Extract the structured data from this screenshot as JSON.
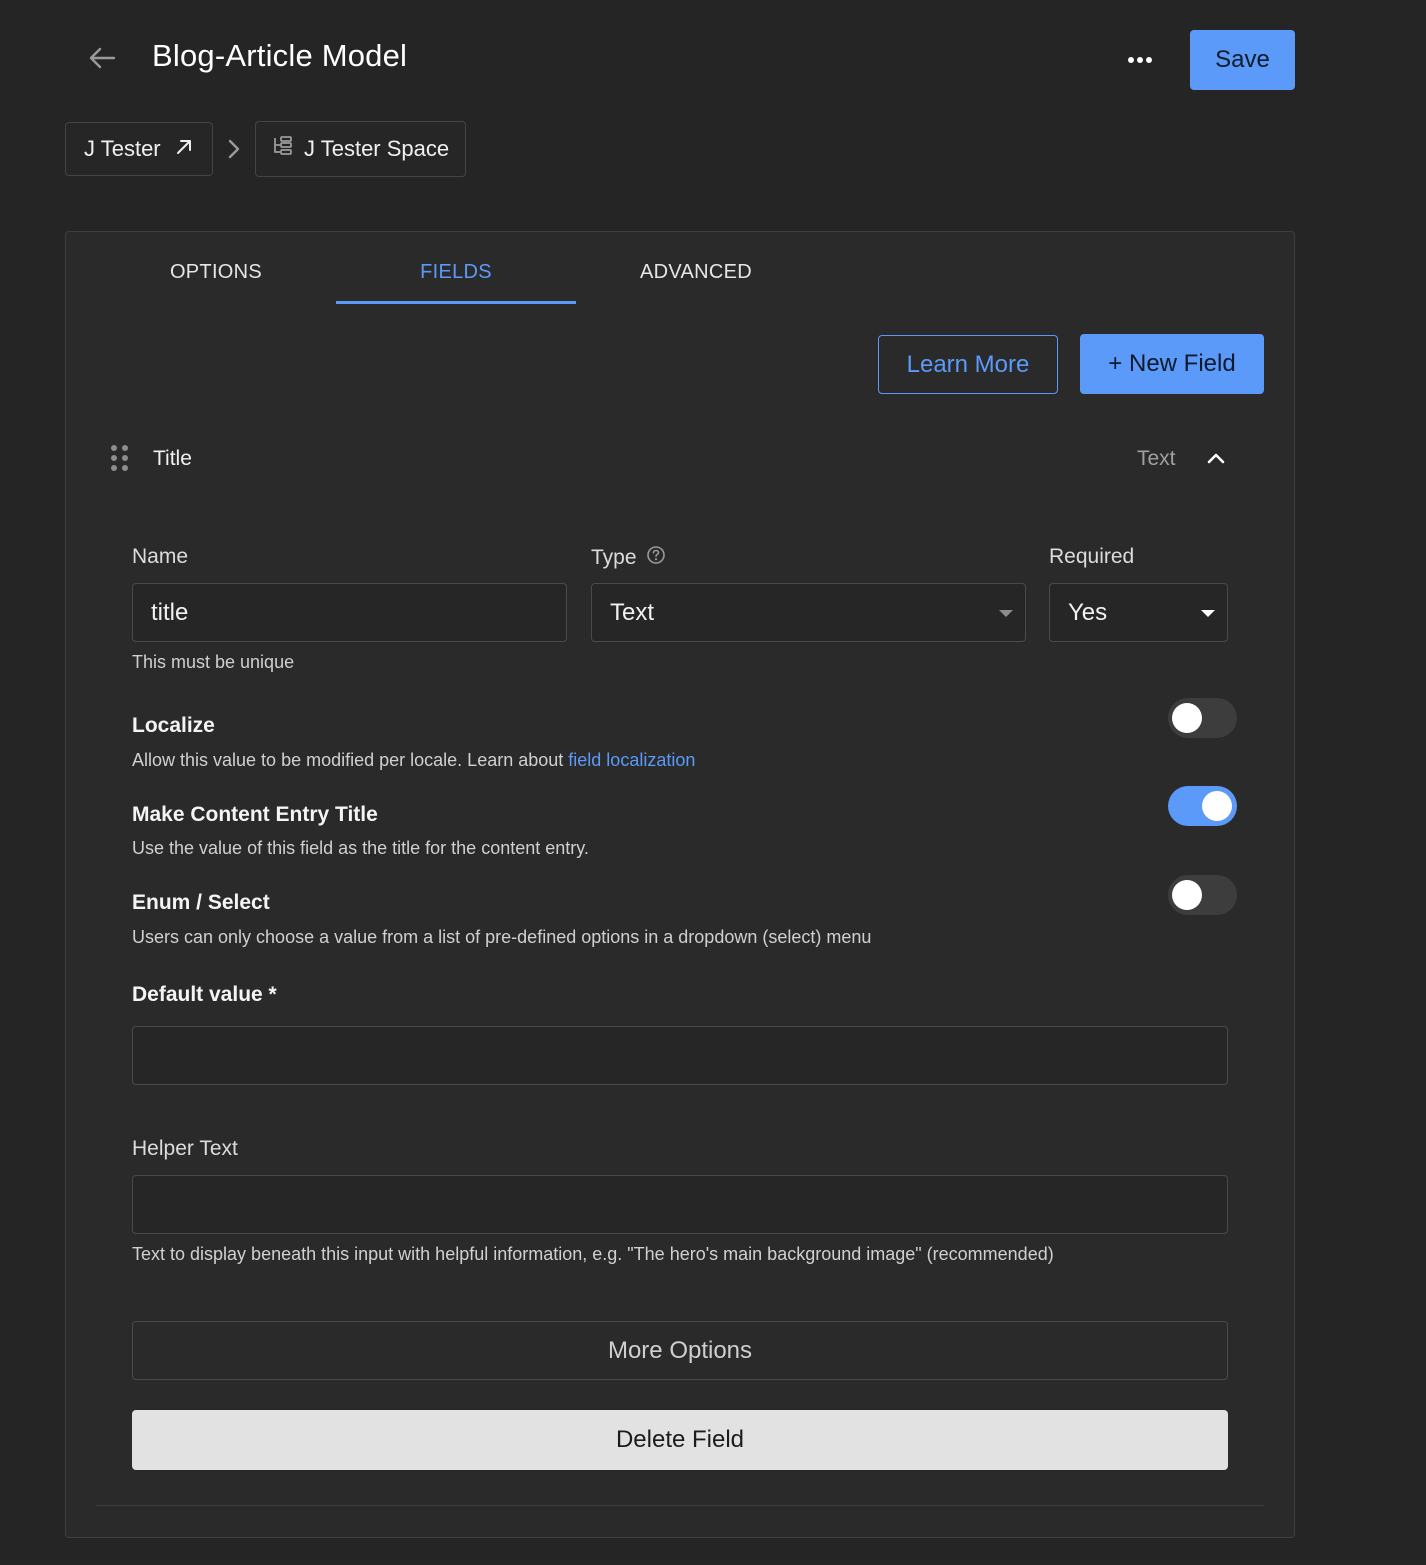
{
  "header": {
    "title": "Blog-Article Model",
    "save_label": "Save",
    "back_icon": "arrow-left-icon",
    "more_icon": "ellipsis-icon"
  },
  "breadcrumb": {
    "org": "J Tester",
    "space": "J Tester Space",
    "org_icon": "external-arrow-icon",
    "space_icon": "tree-icon"
  },
  "tabs": [
    {
      "label": "OPTIONS",
      "active": false
    },
    {
      "label": "FIELDS",
      "active": true
    },
    {
      "label": "ADVANCED",
      "active": false
    }
  ],
  "actions": {
    "learn_more": "Learn More",
    "new_field": "+ New Field"
  },
  "field": {
    "title": "Title",
    "type_label": "Text",
    "expanded": true,
    "name_label": "Name",
    "name_value": "title",
    "name_hint": "This must be unique",
    "type_field_label": "Type",
    "type_value": "Text",
    "required_label": "Required",
    "required_value": "Yes"
  },
  "options": {
    "localize": {
      "title": "Localize",
      "desc": "Allow this value to be modified per locale. Learn about",
      "link": "field localization",
      "enabled": false
    },
    "entry_title": {
      "title": "Make Content Entry Title",
      "desc": "Use the value of this field as the title for the content entry.",
      "enabled": true
    },
    "enum": {
      "title": "Enum / Select",
      "desc": "Users can only choose a value from a list of pre-defined options in a dropdown (select) menu",
      "enabled": false
    }
  },
  "default_value": {
    "label": "Default value *",
    "value": ""
  },
  "helper_text": {
    "label": "Helper Text",
    "value": "",
    "hint": "Text to display beneath this input with helpful information, e.g. \"The hero's main background image\" (recommended)"
  },
  "buttons": {
    "more_options": "More Options",
    "delete_field": "Delete Field"
  },
  "colors": {
    "accent": "#5b9af8",
    "background": "#252525",
    "card": "#2a2a2a"
  }
}
